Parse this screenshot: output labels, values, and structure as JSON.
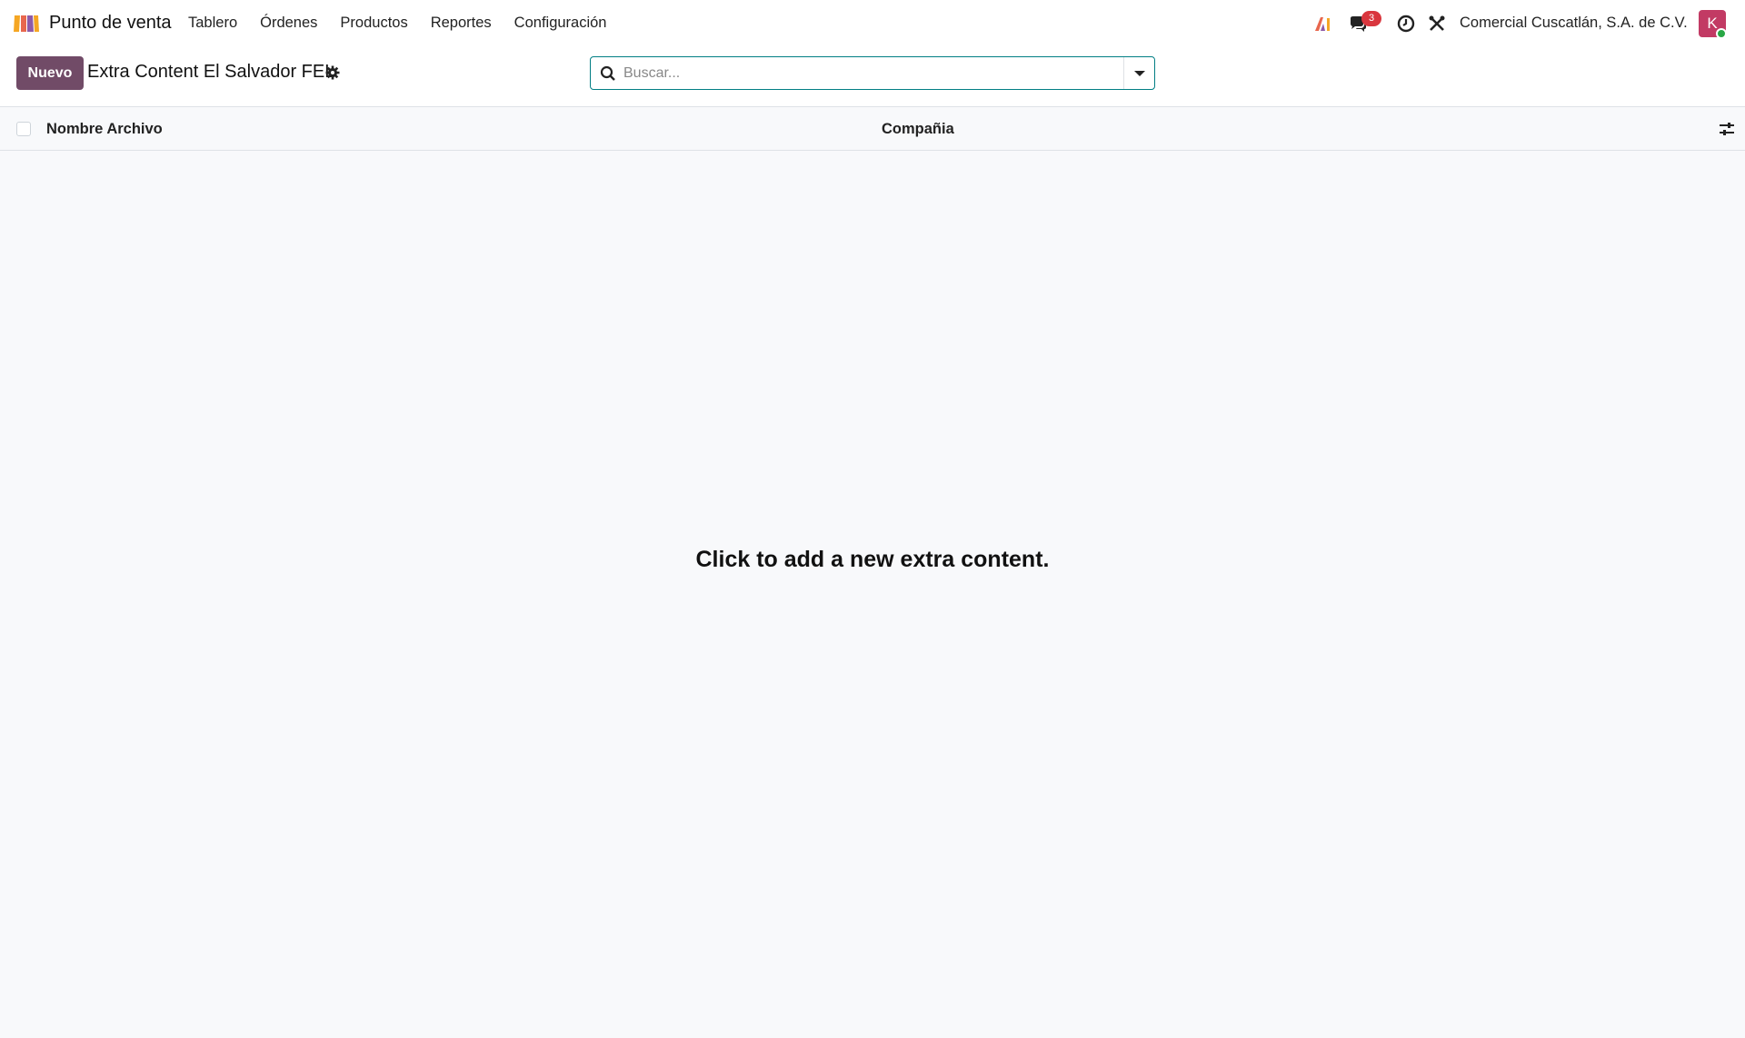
{
  "navbar": {
    "app_name": "Punto de venta",
    "menu": [
      "Tablero",
      "Órdenes",
      "Productos",
      "Reportes",
      "Configuración"
    ],
    "messages_badge": "3",
    "company": "Comercial Cuscatlán, S.A. de C.V.",
    "avatar_letter": "K"
  },
  "control_panel": {
    "new_button": "Nuevo",
    "breadcrumb": "Extra Content El Salvador FEL",
    "search_placeholder": "Buscar..."
  },
  "list": {
    "columns": [
      "Nombre Archivo",
      "Compañia"
    ],
    "rows": []
  },
  "empty_state": "Click to add a new extra content.",
  "colors": {
    "brand": "#714b67",
    "search_border": "#017e84",
    "badge": "#d9363e",
    "avatar": "#c23a64",
    "presence": "#28a745"
  },
  "icons": [
    "app-logo-icon",
    "ai-icon",
    "chat-icon",
    "clock-icon",
    "tools-icon",
    "gear-icon",
    "search-icon",
    "caret-down-icon",
    "sliders-icon"
  ]
}
